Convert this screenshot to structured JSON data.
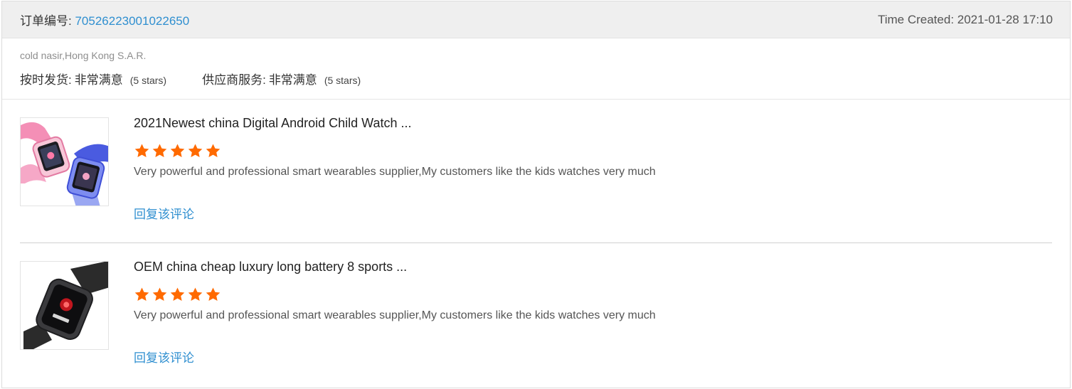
{
  "order": {
    "number_label": "订单编号:",
    "number": "70526223001022650",
    "time_created": "Time Created: 2021-01-28 17:10"
  },
  "buyer": {
    "name": "cold nasir,Hong Kong S.A.R.",
    "ratings": [
      {
        "label": "按时发货:",
        "value": "非常满意",
        "stars_text": "(5 stars)"
      },
      {
        "label": "供应商服务:",
        "value": "非常满意",
        "stars_text": "(5 stars)"
      }
    ]
  },
  "colors": {
    "link": "#2f8fd0",
    "star": "#ff6a00",
    "header_bg": "#efefef"
  },
  "reviews": [
    {
      "title": "2021Newest china Digital Android Child Watch ...",
      "rating": 5,
      "max_rating": 5,
      "text": "Very powerful and professional smart wearables supplier,My customers like the kids watches very much",
      "reply_label": "回复该评论",
      "image": "kids-smartwatch-pink-blue"
    },
    {
      "title": "OEM china cheap luxury long battery 8 sports ...",
      "rating": 5,
      "max_rating": 5,
      "text": "Very powerful and professional smart wearables supplier,My customers like the kids watches very much",
      "reply_label": "回复该评论",
      "image": "black-sports-smartwatch"
    }
  ]
}
